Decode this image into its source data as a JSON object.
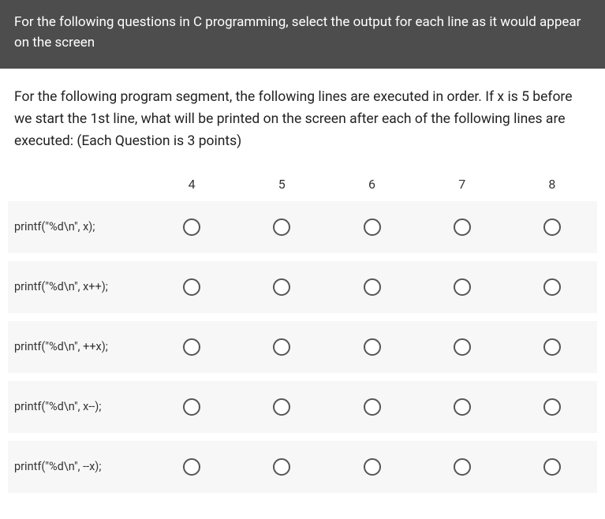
{
  "header": {
    "text": "For the following questions in C programming, select the output for each line as it would appear on the screen"
  },
  "instructions": {
    "text": "For the following program segment, the following lines are executed in order. If x is 5 before we start the 1st line, what will be printed on the screen after each of the following lines are executed: (Each Question is 3 points)"
  },
  "columns": [
    "4",
    "5",
    "6",
    "7",
    "8"
  ],
  "rows": [
    {
      "label": "printf(\"%d\\n\", x);"
    },
    {
      "label": "printf(\"%d\\n\", x++);"
    },
    {
      "label": "printf(\"%d\\n\", ++x);"
    },
    {
      "label": "printf(\"%d\\n\", x--);"
    },
    {
      "label": "printf(\"%d\\n\", --x);"
    }
  ]
}
